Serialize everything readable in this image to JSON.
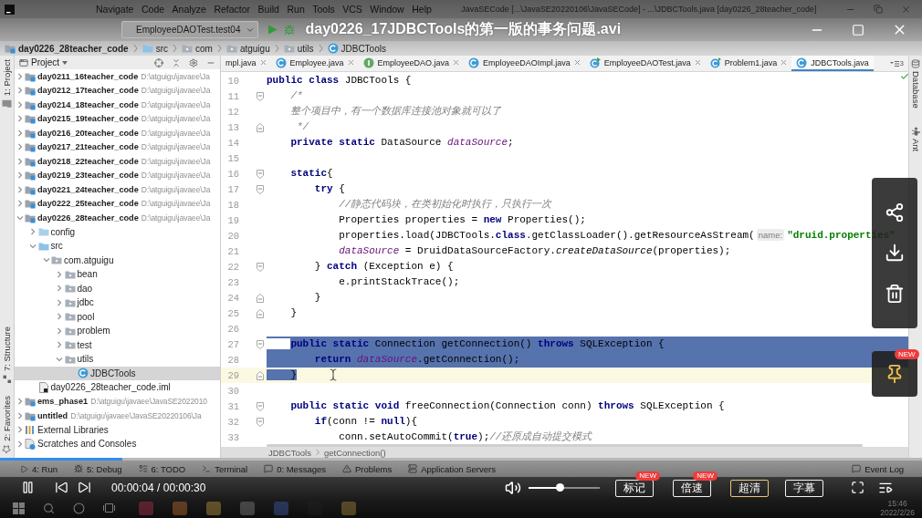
{
  "ide": {
    "menu": [
      "Navigate",
      "Code",
      "Analyze",
      "Refactor",
      "Build",
      "Run",
      "Tools",
      "VCS",
      "Window",
      "Help"
    ],
    "window_title": "JavaSECode [...\\JavaSE20220106\\JavaSECode] - ...\\JDBCTools.java [day0226_28teacher_code]",
    "run_config": "EmployeeDAOTest.test04"
  },
  "player": {
    "title": "day0226_17JDBCTools的第一版的事务问题.avi",
    "playing": true,
    "progress": {
      "level": 0.133
    },
    "time": "00:00:04 / 00:00:30",
    "volume": {
      "level": 0.43
    },
    "buttons": [
      {
        "label": "标记",
        "badge": "NEW",
        "selected": false
      },
      {
        "label": "倍速",
        "badge": "NEW",
        "selected": false
      },
      {
        "label": "超清",
        "selected": true
      },
      {
        "label": "字幕",
        "selected": false
      }
    ],
    "pin_badge": "NEW"
  },
  "breadcrumbs": [
    {
      "label": "day0226_28teacher_code",
      "kind": "module"
    },
    {
      "label": "src",
      "kind": "source_folder"
    },
    {
      "label": "com",
      "kind": "package"
    },
    {
      "label": "atguigu",
      "kind": "package"
    },
    {
      "label": "utils",
      "kind": "package"
    },
    {
      "label": "JDBCTools",
      "kind": "class"
    }
  ],
  "left_stripe": {
    "top": [
      {
        "label": "1: Project",
        "kind": "project"
      }
    ],
    "bottom": [
      {
        "label": "7: Structure",
        "kind": "structure"
      },
      {
        "label": "2: Favorites",
        "kind": "favorites"
      }
    ]
  },
  "project": {
    "title": "Project",
    "tree": [
      {
        "label": "day0211_16teacher_code",
        "path": "D:\\atguigu\\javaee\\Ja",
        "kind": "module",
        "expanded": false,
        "selected": false
      },
      {
        "label": "day0212_17teacher_code",
        "path": "D:\\atguigu\\javaee\\Ja",
        "kind": "module",
        "expanded": false,
        "selected": false
      },
      {
        "label": "day0214_18teacher_code",
        "path": "D:\\atguigu\\javaee\\Ja",
        "kind": "module",
        "expanded": false,
        "selected": false
      },
      {
        "label": "day0215_19teacher_code",
        "path": "D:\\atguigu\\javaee\\Ja",
        "kind": "module",
        "expanded": false,
        "selected": false
      },
      {
        "label": "day0216_20teacher_code",
        "path": "D:\\atguigu\\javaee\\Ja",
        "kind": "module",
        "expanded": false,
        "selected": false
      },
      {
        "label": "day0217_21teacher_code",
        "path": "D:\\atguigu\\javaee\\Ja",
        "kind": "module",
        "expanded": false,
        "selected": false
      },
      {
        "label": "day0218_22teacher_code",
        "path": "D:\\atguigu\\javaee\\Ja",
        "kind": "module",
        "expanded": false,
        "selected": false
      },
      {
        "label": "day0219_23teacher_code",
        "path": "D:\\atguigu\\javaee\\Ja",
        "kind": "module",
        "expanded": false,
        "selected": false
      },
      {
        "label": "day0221_24teacher_code",
        "path": "D:\\atguigu\\javaee\\Ja",
        "kind": "module",
        "expanded": false,
        "selected": false
      },
      {
        "label": "day0222_25teacher_code",
        "path": "D:\\atguigu\\javaee\\Ja",
        "kind": "module",
        "expanded": false,
        "selected": false
      },
      {
        "label": "day0226_28teacher_code",
        "path": "D:\\atguigu\\javaee\\Ja",
        "kind": "module",
        "expanded": true,
        "selected": false,
        "children": [
          {
            "label": "config",
            "kind": "folder",
            "expanded": false,
            "selected": false
          },
          {
            "label": "src",
            "kind": "source_folder",
            "expanded": true,
            "selected": false,
            "children": [
              {
                "label": "com.atguigu",
                "kind": "package",
                "expanded": true,
                "selected": false,
                "children": [
                  {
                    "label": "bean",
                    "kind": "package",
                    "expanded": false,
                    "selected": false
                  },
                  {
                    "label": "dao",
                    "kind": "package",
                    "expanded": false,
                    "selected": false
                  },
                  {
                    "label": "jdbc",
                    "kind": "package",
                    "expanded": false,
                    "selected": false
                  },
                  {
                    "label": "pool",
                    "kind": "package",
                    "expanded": false,
                    "selected": false
                  },
                  {
                    "label": "problem",
                    "kind": "package",
                    "expanded": false,
                    "selected": false
                  },
                  {
                    "label": "test",
                    "kind": "package",
                    "expanded": false,
                    "selected": false
                  },
                  {
                    "label": "utils",
                    "kind": "package",
                    "expanded": true,
                    "selected": false,
                    "children": [
                      {
                        "label": "JDBCTools",
                        "kind": "class",
                        "selected": true
                      }
                    ]
                  }
                ]
              }
            ]
          },
          {
            "label": "day0226_28teacher_code.iml",
            "kind": "module_file",
            "selected": false
          }
        ]
      },
      {
        "label": "ems_phase1",
        "path": "D:\\atguigu\\javaee\\JavaSE2022010",
        "kind": "module",
        "expanded": false,
        "selected": false
      },
      {
        "label": "untitled",
        "path": "D:\\atguigu\\javaee\\JavaSE20220106\\Ja",
        "kind": "module",
        "expanded": false,
        "selected": false
      },
      {
        "label": "External Libraries",
        "kind": "libraries",
        "expanded": false,
        "selected": false
      },
      {
        "label": "Scratches and Consoles",
        "kind": "scratches",
        "expanded": false,
        "selected": false
      }
    ]
  },
  "editor": {
    "tabs": [
      {
        "label": "mpl.java",
        "selected": false,
        "closable": true
      },
      {
        "label": "Employee.java",
        "kind": "class",
        "selected": false,
        "closable": true
      },
      {
        "label": "EmployeeDAO.java",
        "kind": "interface",
        "selected": false,
        "closable": true
      },
      {
        "label": "EmployeeDAOImpl.java",
        "kind": "class",
        "selected": false,
        "closable": true
      },
      {
        "label": "EmployeeDAOTest.java",
        "kind": "test_class",
        "selected": false,
        "closable": true
      },
      {
        "label": "Problem1.java",
        "kind": "main_class",
        "selected": false,
        "closable": true
      },
      {
        "label": "JDBCTools.java",
        "kind": "class",
        "selected": true,
        "closable": false
      }
    ],
    "tabs_overflow": "3",
    "lines": [
      {
        "number": "10",
        "selected": false,
        "tokens": [
          {
            "kind": "keyword",
            "text": "public"
          },
          {
            "kind": "keyword",
            "text": " class"
          },
          {
            "kind": "plain",
            "text": " JDBCTools {"
          }
        ]
      },
      {
        "number": "11",
        "selected": false,
        "fold_start": true,
        "tokens": [
          {
            "kind": "comment",
            "text": "    /*"
          }
        ]
      },
      {
        "number": "12",
        "selected": false,
        "tokens": [
          {
            "kind": "comment",
            "text": "    整个项目中，有一个数据库连接池对象就可以了"
          }
        ]
      },
      {
        "number": "13",
        "selected": false,
        "fold_end": true,
        "tokens": [
          {
            "kind": "comment",
            "text": "     */"
          }
        ]
      },
      {
        "number": "14",
        "selected": false,
        "tokens": [
          {
            "kind": "keyword",
            "text": "    private"
          },
          {
            "kind": "keyword",
            "text": " static"
          },
          {
            "kind": "plain",
            "text": " DataSource "
          },
          {
            "kind": "field",
            "text": "dataSource"
          },
          {
            "kind": "plain",
            "text": ";"
          }
        ]
      },
      {
        "number": "15",
        "selected": false
      },
      {
        "number": "16",
        "selected": false,
        "fold_start": true,
        "tokens": [
          {
            "kind": "keyword",
            "text": "    static"
          },
          {
            "kind": "plain",
            "text": "{"
          }
        ]
      },
      {
        "number": "17",
        "selected": false,
        "fold_start": true,
        "tokens": [
          {
            "kind": "keyword",
            "text": "        try"
          },
          {
            "kind": "plain",
            "text": " {"
          }
        ]
      },
      {
        "number": "18",
        "selected": false,
        "tokens": [
          {
            "kind": "comment",
            "text": "            //静态代码块，在类初始化时执行，只执行一次"
          }
        ]
      },
      {
        "number": "19",
        "selected": false,
        "tokens": [
          {
            "kind": "plain",
            "text": "            Properties properties = "
          },
          {
            "kind": "keyword",
            "text": "new"
          },
          {
            "kind": "plain",
            "text": " Properties();"
          }
        ]
      },
      {
        "number": "20",
        "selected": false,
        "tokens": [
          {
            "kind": "plain",
            "text": "            properties.load(JDBCTools."
          },
          {
            "kind": "keyword",
            "text": "class"
          },
          {
            "kind": "plain",
            "text": ".getClassLoader().getResourceAsStream("
          },
          {
            "kind": "hint",
            "text": "name:"
          },
          {
            "kind": "string",
            "text": "\"druid.properties\""
          }
        ]
      },
      {
        "number": "21",
        "selected": false,
        "tokens": [
          {
            "kind": "field",
            "text": "            dataSource"
          },
          {
            "kind": "plain",
            "text": " = DruidDataSourceFactory."
          },
          {
            "kind": "static_call",
            "text": "createDataSource"
          },
          {
            "kind": "plain",
            "text": "(properties);"
          }
        ]
      },
      {
        "number": "22",
        "selected": false,
        "fold_start": true,
        "tokens": [
          {
            "kind": "plain",
            "text": "        } "
          },
          {
            "kind": "keyword",
            "text": "catch"
          },
          {
            "kind": "plain",
            "text": " (Exception e) {"
          }
        ]
      },
      {
        "number": "23",
        "selected": false,
        "tokens": [
          {
            "kind": "plain",
            "text": "            e.printStackTrace();"
          }
        ]
      },
      {
        "number": "24",
        "selected": false,
        "fold_end": true,
        "tokens": [
          {
            "kind": "plain",
            "text": "        }"
          }
        ]
      },
      {
        "number": "25",
        "selected": false,
        "fold_end": true,
        "tokens": [
          {
            "kind": "plain",
            "text": "    }"
          }
        ]
      },
      {
        "number": "26",
        "selected": false
      },
      {
        "number": "27",
        "selected": true,
        "fold_start": true,
        "tokens": [
          {
            "kind": "keyword",
            "text": "    public"
          },
          {
            "kind": "keyword",
            "text": " static"
          },
          {
            "kind": "plain",
            "text": " Connection getConnection() "
          },
          {
            "kind": "keyword",
            "text": "throws"
          },
          {
            "kind": "plain",
            "text": " SQLException {"
          }
        ]
      },
      {
        "number": "28",
        "selected": true,
        "tokens": [
          {
            "kind": "keyword",
            "text": "        return"
          },
          {
            "kind": "field",
            "text": " dataSource"
          },
          {
            "kind": "plain",
            "text": ".getConnection();"
          }
        ]
      },
      {
        "number": "29",
        "selected": true,
        "fold_end": true,
        "caret_line": true,
        "tokens": [
          {
            "kind": "plain",
            "text": "    }"
          }
        ]
      },
      {
        "number": "30",
        "selected": false
      },
      {
        "number": "31",
        "selected": false,
        "fold_start": true,
        "tokens": [
          {
            "kind": "keyword",
            "text": "    public"
          },
          {
            "kind": "keyword",
            "text": " static"
          },
          {
            "kind": "keyword",
            "text": " void"
          },
          {
            "kind": "plain",
            "text": " freeConnection(Connection conn) "
          },
          {
            "kind": "keyword",
            "text": "throws"
          },
          {
            "kind": "plain",
            "text": " SQLException {"
          }
        ]
      },
      {
        "number": "32",
        "selected": false,
        "fold_start": true,
        "tokens": [
          {
            "kind": "keyword",
            "text": "        if"
          },
          {
            "kind": "plain",
            "text": "(conn != "
          },
          {
            "kind": "keyword",
            "text": "null"
          },
          {
            "kind": "plain",
            "text": "){"
          }
        ]
      },
      {
        "number": "33",
        "selected": false,
        "tokens": [
          {
            "kind": "plain",
            "text": "            conn.setAutoCommit("
          },
          {
            "kind": "keyword",
            "text": "true"
          },
          {
            "kind": "plain",
            "text": ");"
          },
          {
            "kind": "comment",
            "text": "//还原成自动提交模式"
          }
        ]
      }
    ],
    "breadcrumbs": [
      "JDBCTools",
      "getConnection()"
    ]
  },
  "right_stripe": [
    {
      "label": "Database",
      "kind": "database"
    },
    {
      "label": "Ant",
      "kind": "ant"
    }
  ],
  "tool_windows": {
    "left": [
      {
        "label": "4: Run",
        "kind": "run"
      },
      {
        "label": "5: Debug",
        "kind": "debug"
      },
      {
        "label": "6: TODO",
        "kind": "todo"
      },
      {
        "label": "Terminal",
        "kind": "terminal"
      },
      {
        "label": "0: Messages",
        "kind": "messages"
      },
      {
        "label": "Problems",
        "kind": "problems"
      },
      {
        "label": "Application Servers",
        "kind": "servers"
      }
    ],
    "right": [
      {
        "label": "Event Log",
        "kind": "event_log"
      }
    ]
  },
  "taskbar": {
    "time": "15:46",
    "date": "2022/2/26"
  }
}
